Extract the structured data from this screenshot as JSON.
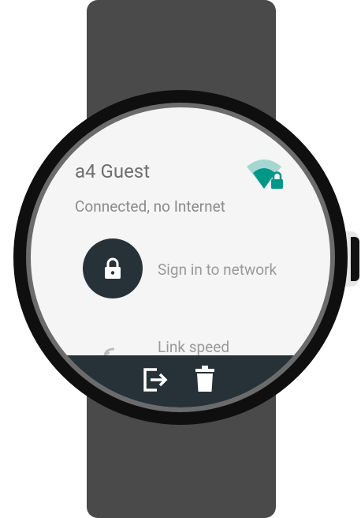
{
  "network": {
    "name": "a4 Guest",
    "status": "Connected, no Internet"
  },
  "actions": {
    "sign_in_label": "Sign in to network",
    "link_speed_label": "Link speed"
  },
  "icons": {
    "wifi": "wifi-lock-icon",
    "lock": "lock-icon",
    "link_speed": "signal-icon",
    "exit": "exit-icon",
    "delete": "trash-icon"
  },
  "colors": {
    "accent": "#009688",
    "dark": "#263238",
    "band": "#4a4a4a"
  }
}
